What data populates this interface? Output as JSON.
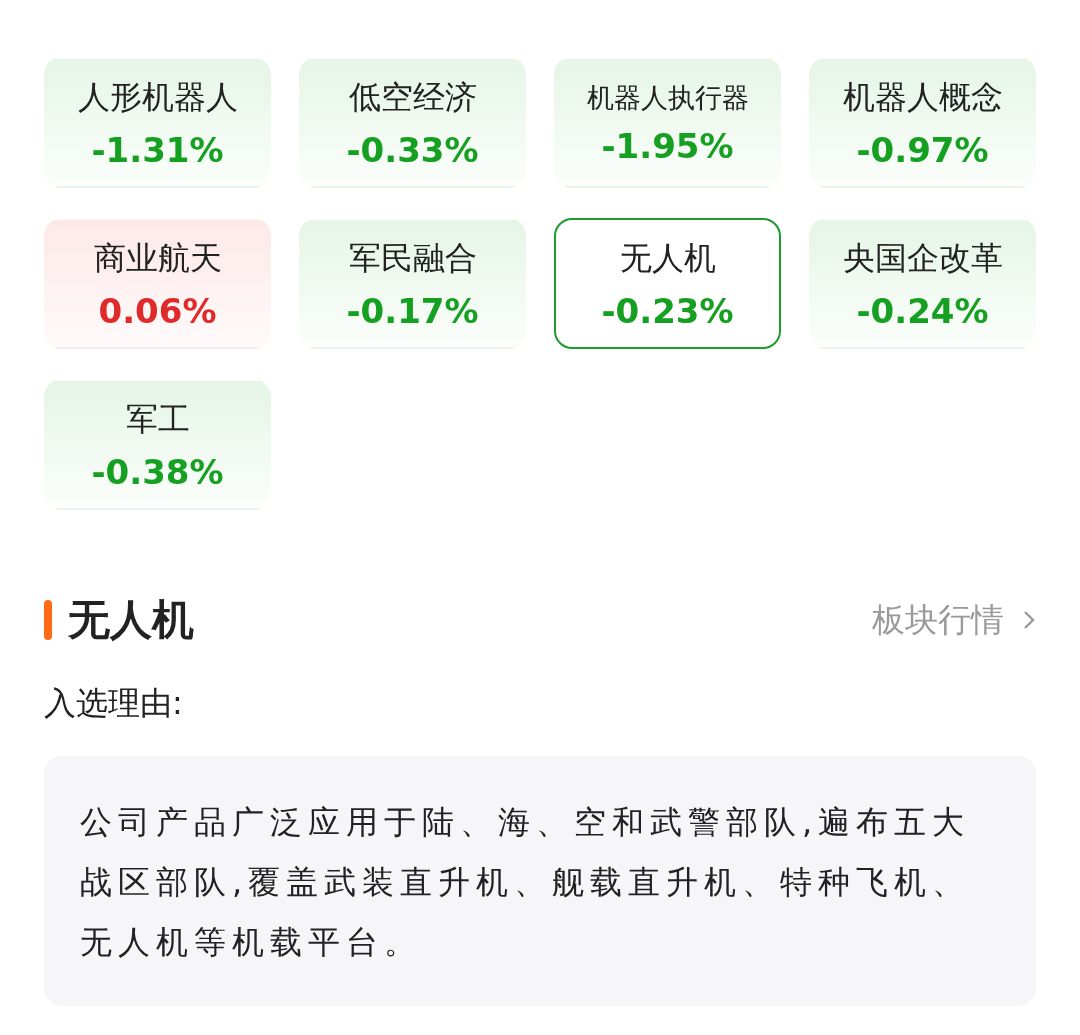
{
  "sectors": [
    {
      "name": "人形机器人",
      "change": "-1.31%",
      "kind": "fall",
      "selected": false
    },
    {
      "name": "低空经济",
      "change": "-0.33%",
      "kind": "fall",
      "selected": false
    },
    {
      "name": "机器人执行器",
      "change": "-1.95%",
      "kind": "fall",
      "selected": false
    },
    {
      "name": "机器人概念",
      "change": "-0.97%",
      "kind": "fall",
      "selected": false
    },
    {
      "name": "商业航天",
      "change": "0.06%",
      "kind": "rise",
      "selected": false
    },
    {
      "name": "军民融合",
      "change": "-0.17%",
      "kind": "fall",
      "selected": false
    },
    {
      "name": "无人机",
      "change": "-0.23%",
      "kind": "fall",
      "selected": true
    },
    {
      "name": "央国企改革",
      "change": "-0.24%",
      "kind": "fall",
      "selected": false
    },
    {
      "name": "军工",
      "change": "-0.38%",
      "kind": "fall",
      "selected": false
    }
  ],
  "detail": {
    "title": "无人机",
    "link": "板块行情",
    "reason_label": "入选理由:",
    "reason": "公司产品广泛应用于陆、海、空和武警部队,遍布五大战区部队,覆盖武装直升机、舰载直升机、特种飞机、无人机等机载平台。"
  }
}
